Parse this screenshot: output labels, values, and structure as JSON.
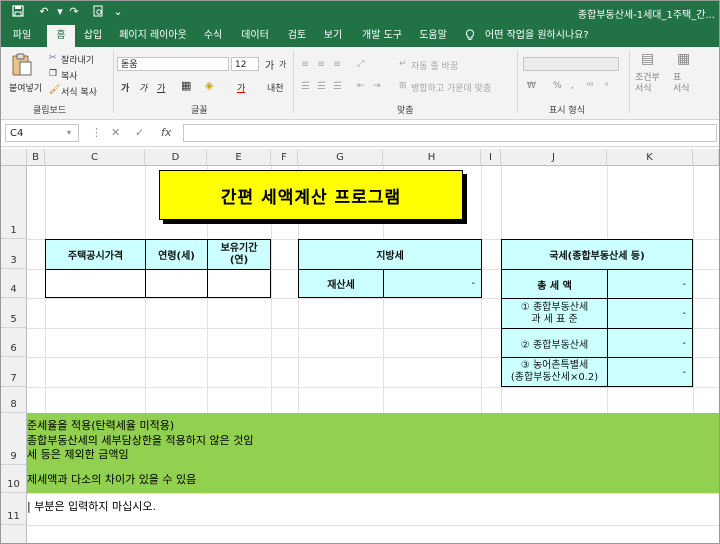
{
  "title_bar": {
    "document_title": "종합부동산세-1세대_1주택_간..."
  },
  "tabs": [
    "파일",
    "홈",
    "삽입",
    "페이지 레이아웃",
    "수식",
    "데이터",
    "검토",
    "보기",
    "개발 도구",
    "도움말"
  ],
  "active_tab": "홈",
  "tell_me": "어떤 작업을 원하시나요?",
  "ribbon": {
    "clipboard": {
      "paste_label": "붙여넣기",
      "cut": "잘라내기",
      "copy": "복사",
      "format_painter": "서식 복사",
      "group_label": "클립보드"
    },
    "font": {
      "font_name": "돋움",
      "font_size": "12",
      "grow": "가",
      "shrink": "가",
      "bold": "가",
      "italic": "가",
      "underline": "가",
      "phonetic": "내천",
      "group_label": "글꼴"
    },
    "alignment": {
      "wrap_text": "자동 줄 바꿈",
      "merge_center": "병합하고 가운데 맞춤",
      "group_label": "맞춤"
    },
    "number": {
      "percent": "%",
      "comma": ",",
      "group_label": "표시 형식"
    },
    "styles": {
      "conditional": "조건부\n서식",
      "table_format": "표\n서식"
    }
  },
  "formula_bar": {
    "name_box": "C4",
    "formula": ""
  },
  "columns": [
    "B",
    "C",
    "D",
    "E",
    "F",
    "G",
    "H",
    "I",
    "J",
    "K"
  ],
  "rows": [
    "1",
    "3",
    "4",
    "5",
    "6",
    "7",
    "8",
    "9",
    "10",
    "11"
  ],
  "sheet": {
    "title": "간편 세액계산 프로그램",
    "input_headers": {
      "price": "주택공시가격",
      "age": "연령(세)",
      "holding": "보유기간\n(연)"
    },
    "local_tax": {
      "header": "지방세",
      "property_tax_label": "재산세",
      "property_tax_value": "-"
    },
    "national_tax": {
      "header": "국세(종합부동산세 등)",
      "total_label": "총 세 액",
      "total_value": "-",
      "row1_label": "① 종합부동산세\n과 세 표 준",
      "row1_value": "-",
      "row2_label": "② 종합부동산세",
      "row2_value": "-",
      "row3_label": "③ 농어촌특별세\n(종합부동산세×0.2)",
      "row3_value": "-"
    },
    "notes": [
      "준세율을 적용(탄력세율 미적용)",
      "종합부동산세의 세부담상한을 적용하지 않은 것임",
      "세 등은 제외한 금액임",
      "제세액과 다소의 차이가 있을 수 있음"
    ],
    "footer": "| 부분은 입력하지 마십시오."
  }
}
